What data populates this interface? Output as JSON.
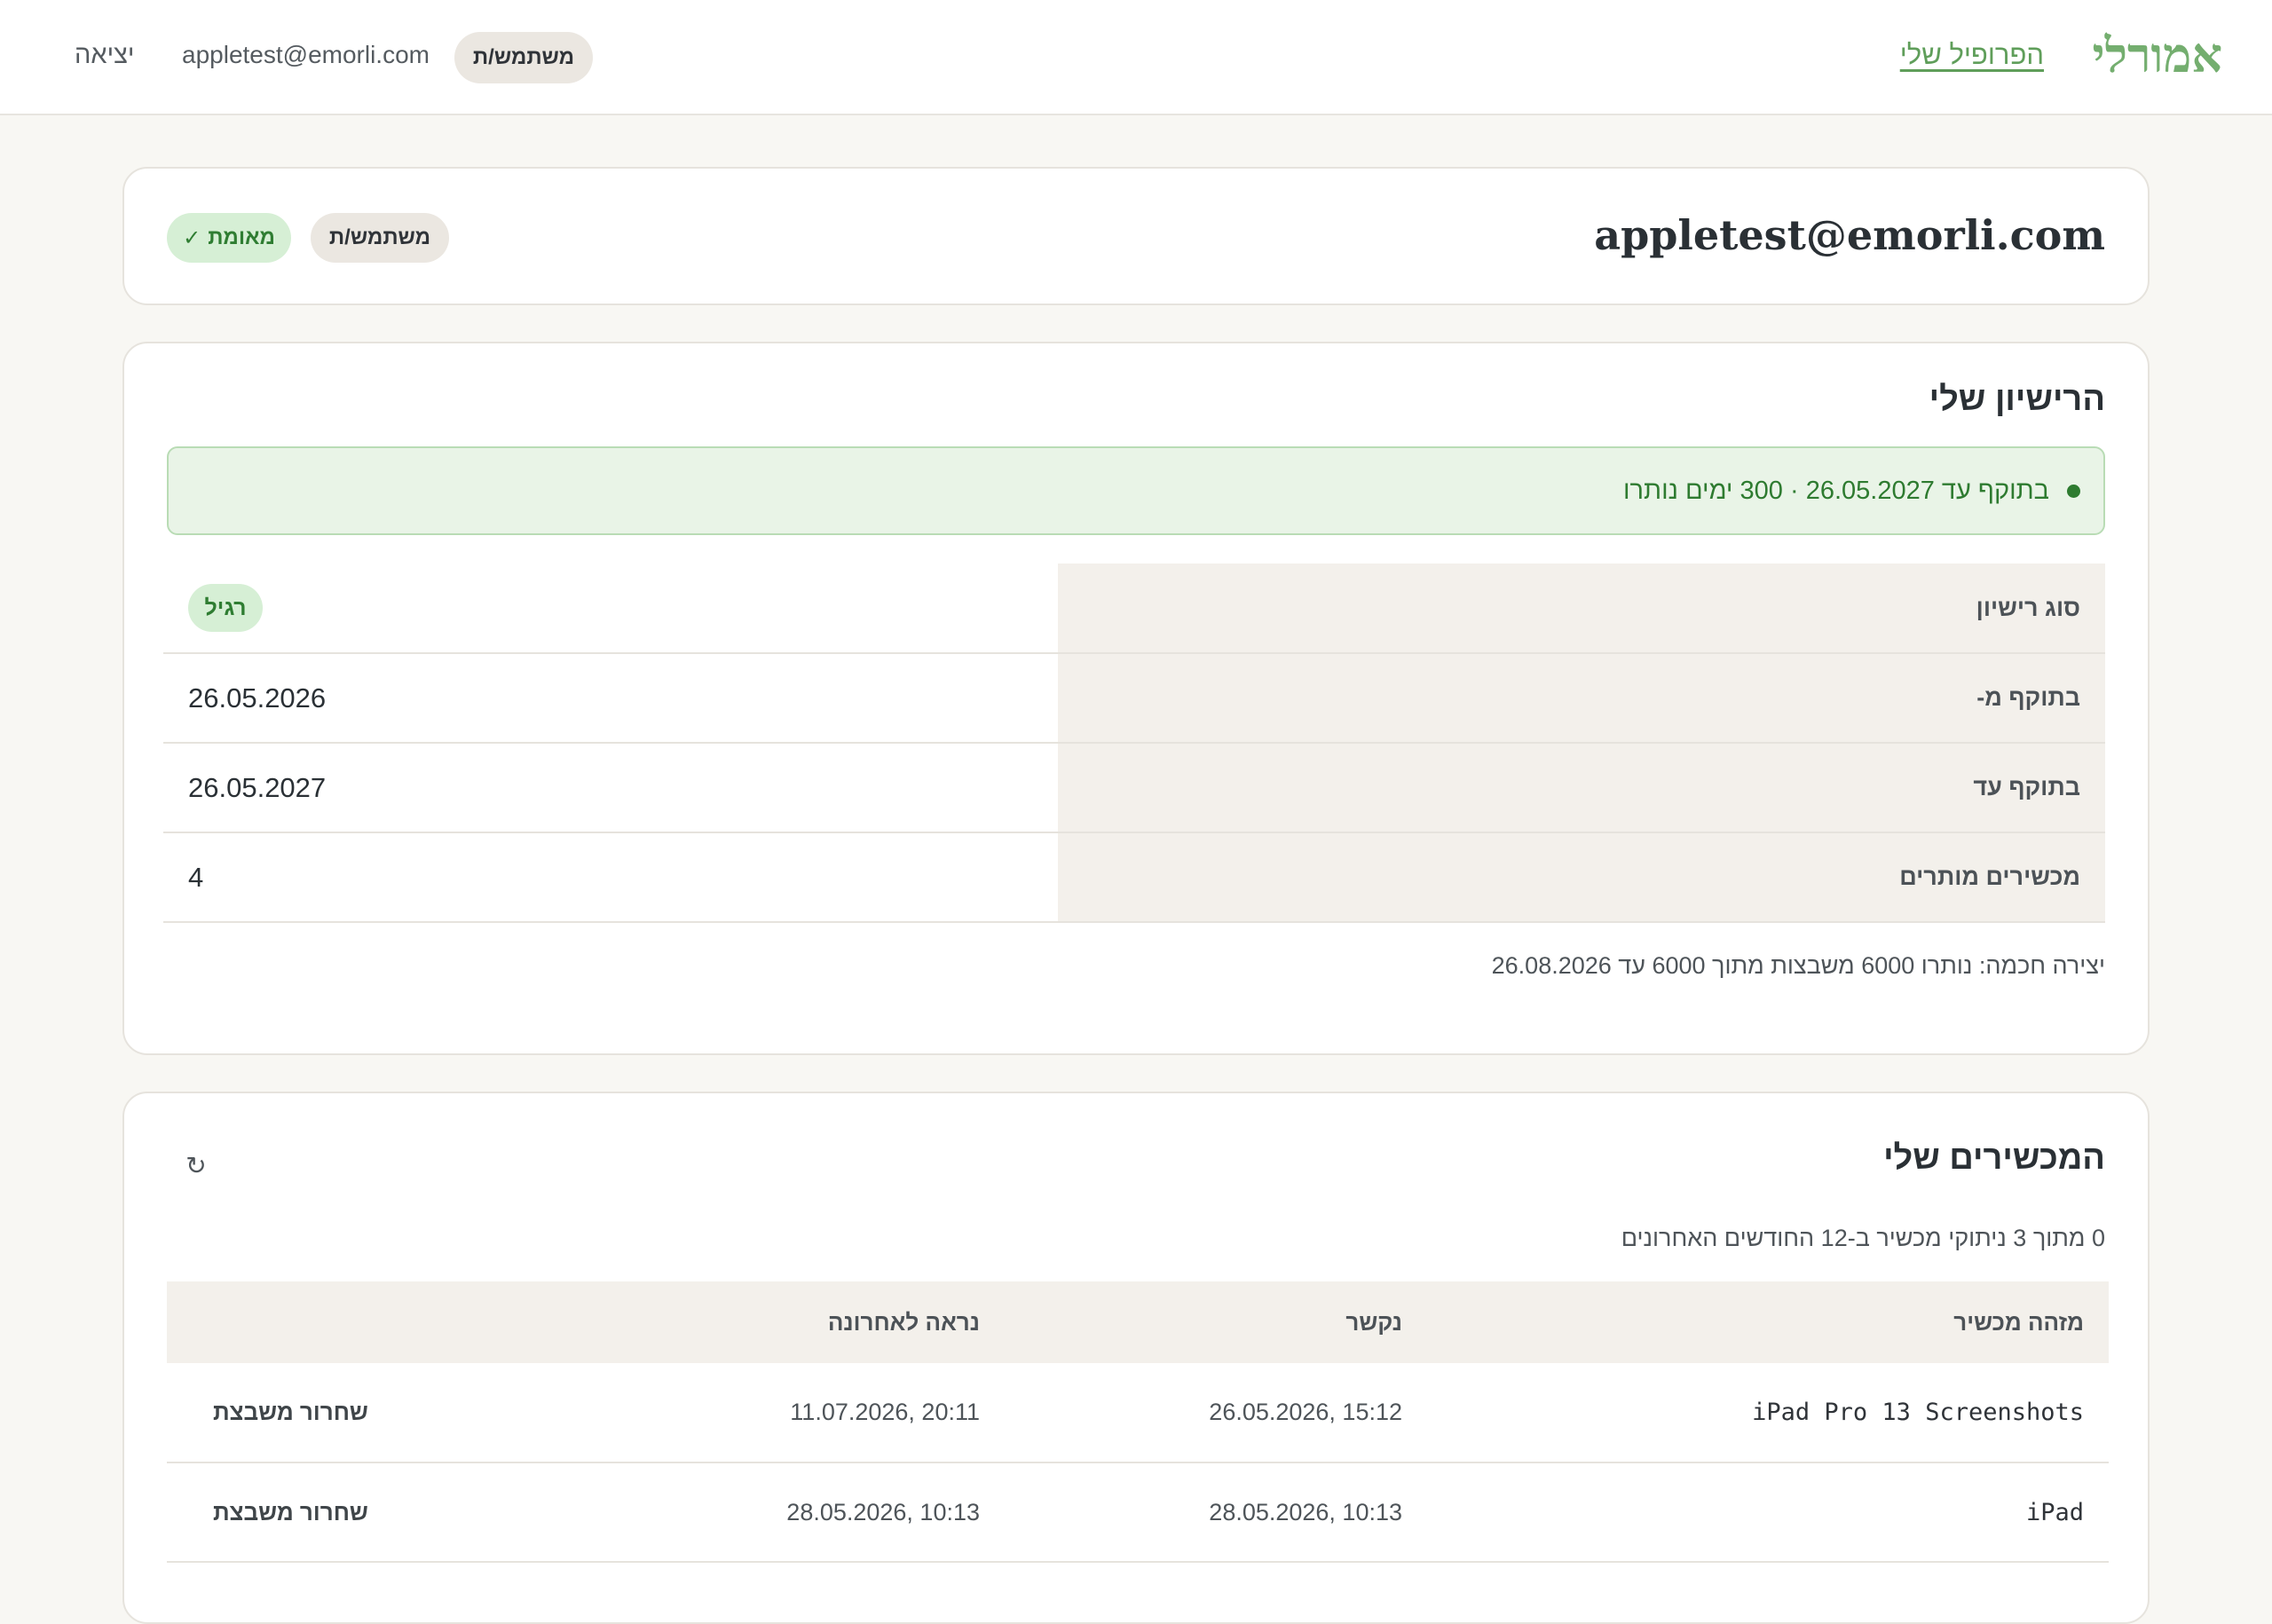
{
  "header": {
    "brand": "אמורלי",
    "profile_link": "הפרופיל שלי",
    "role_badge": "משתמש/ת",
    "email": "appletest@emorli.com",
    "logout": "יציאה"
  },
  "account": {
    "email": "appletest@emorli.com",
    "role_badge": "משתמש/ת",
    "verified_check": "✓",
    "verified_label": "מאומת"
  },
  "license": {
    "title": "הרישיון שלי",
    "status": "בתוקף עד 26.05.2027 · 300 ימים נותרו",
    "rows": [
      {
        "label": "סוג רישיון",
        "value": "רגיל"
      },
      {
        "label": "בתוקף מ-",
        "value": "26.05.2026"
      },
      {
        "label": "בתוקף עד",
        "value": "26.05.2027"
      },
      {
        "label": "מכשירים מותרים",
        "value": "4"
      }
    ],
    "ai_note": "יצירה חכמה: נותרו 6000 משבצות מתוך 6000 עד 26.08.2026"
  },
  "devices": {
    "title": "המכשירים שלי",
    "refresh_icon": "↻",
    "activation_note": "0 מתוך 3 ניתוקי מכשיר ב-12 החודשים האחרונים",
    "columns": [
      "מזהה מכשיר",
      "נקשר",
      "נראה לאחרונה",
      ""
    ],
    "rows": [
      {
        "id": "iPad Pro 13 Screenshots",
        "linked": "26.05.2026, 15:12",
        "last_seen": "11.07.2026, 20:11",
        "action": "שחרור משבצת"
      },
      {
        "id": "iPad",
        "linked": "28.05.2026, 10:13",
        "last_seen": "28.05.2026, 10:13",
        "action": "שחרור משבצת"
      }
    ]
  }
}
